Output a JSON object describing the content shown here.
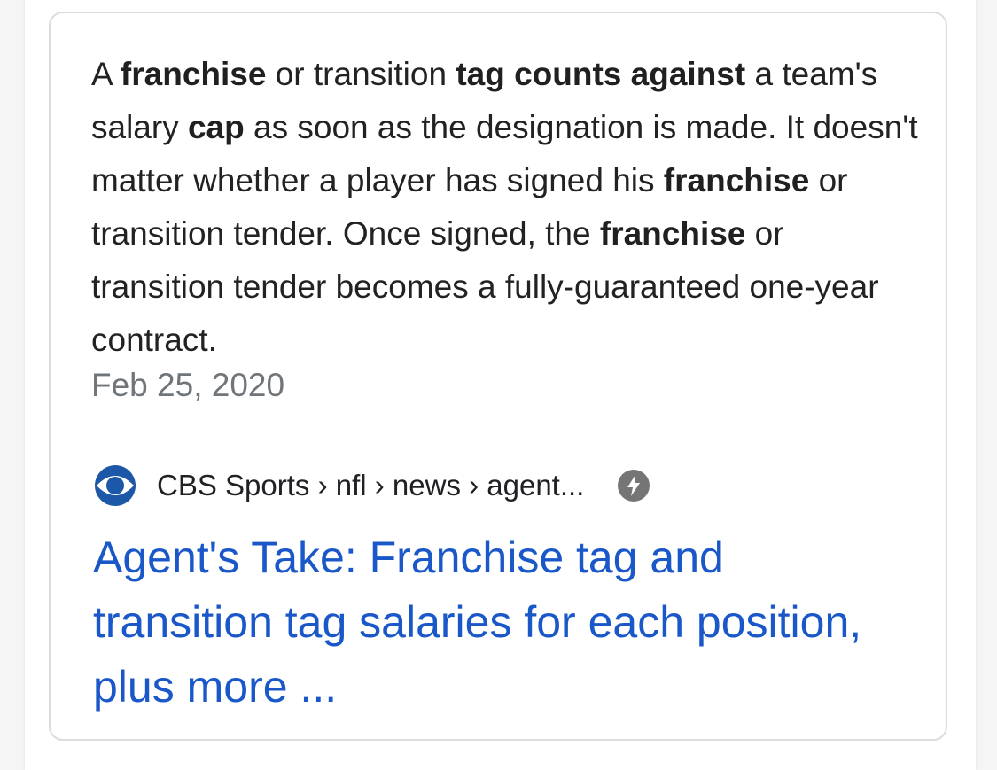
{
  "snippet": {
    "parts": [
      "A ",
      "franchise",
      " or transition ",
      "tag counts against",
      " a team's salary ",
      "cap",
      " as soon as the designation is made. It doesn't matter whether a player has signed his ",
      "franchise",
      " or transition tender. Once signed, the ",
      "franchise",
      " or transition tender becomes a fully-guaranteed one-year contract."
    ],
    "date": "Feb 25, 2020"
  },
  "source": {
    "logo_icon": "cbs-eye-icon",
    "breadcrumb": "CBS Sports › nfl › news › agent...",
    "amp_icon": "amp-lightning-icon"
  },
  "result": {
    "title": "Agent's Take: Franchise tag and transition tag salaries for each position, plus more ..."
  },
  "colors": {
    "link_blue": "#1a57c8",
    "body_text": "#222222",
    "date_gray": "#70757a",
    "card_border": "#dcdcdc"
  }
}
